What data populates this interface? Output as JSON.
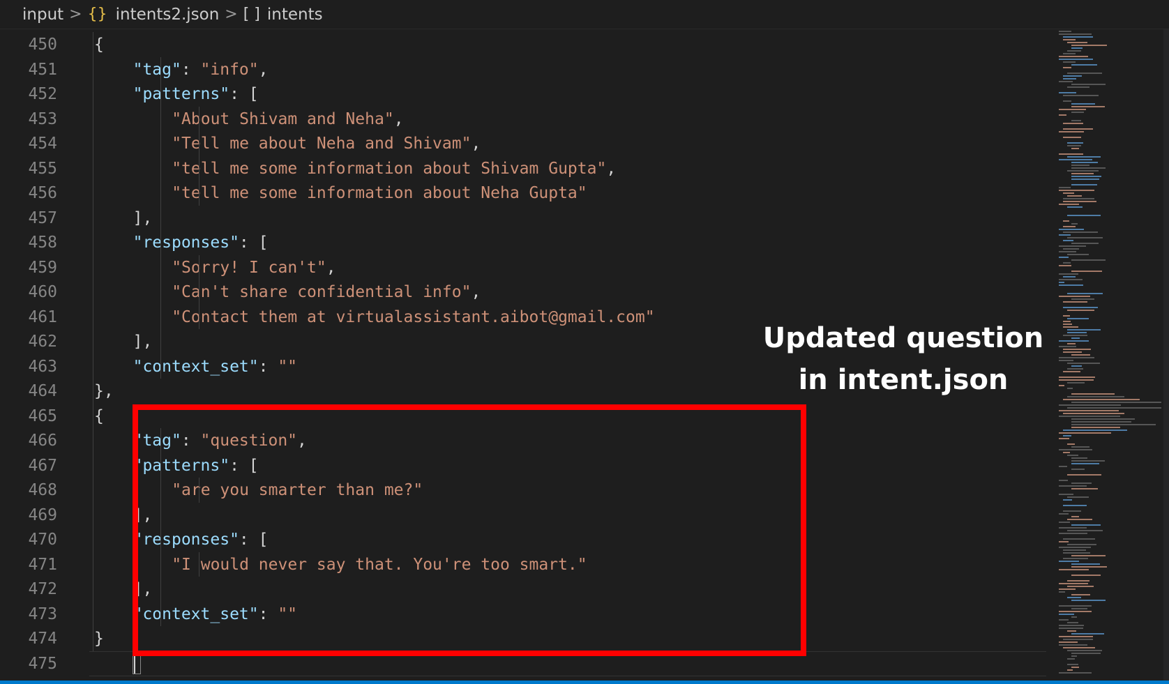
{
  "breadcrumb": {
    "folder": "input",
    "file_icon": "{}",
    "file": "intents2.json",
    "array_icon": "[ ]",
    "symbol": "intents"
  },
  "editor": {
    "lines": [
      {
        "n": "450",
        "segs": [
          [
            "p",
            "{"
          ]
        ]
      },
      {
        "n": "451",
        "segs": [
          [
            "k",
            "\"tag\""
          ],
          [
            "p",
            ": "
          ],
          [
            "s",
            "\"info\""
          ],
          [
            "p",
            ","
          ]
        ]
      },
      {
        "n": "452",
        "segs": [
          [
            "k",
            "\"patterns\""
          ],
          [
            "p",
            ": ["
          ]
        ]
      },
      {
        "n": "453",
        "segs": [
          [
            "s",
            "\"About Shivam and Neha\""
          ],
          [
            "p",
            ","
          ]
        ]
      },
      {
        "n": "454",
        "segs": [
          [
            "s",
            "\"Tell me about Neha and Shivam\""
          ],
          [
            "p",
            ","
          ]
        ]
      },
      {
        "n": "455",
        "segs": [
          [
            "s",
            "\"tell me some information about Shivam Gupta\""
          ],
          [
            "p",
            ","
          ]
        ]
      },
      {
        "n": "456",
        "segs": [
          [
            "s",
            "\"tell me some information about Neha Gupta\""
          ]
        ]
      },
      {
        "n": "457",
        "segs": [
          [
            "p",
            "],"
          ]
        ]
      },
      {
        "n": "458",
        "segs": [
          [
            "k",
            "\"responses\""
          ],
          [
            "p",
            ": ["
          ]
        ]
      },
      {
        "n": "459",
        "segs": [
          [
            "s",
            "\"Sorry! I can't\""
          ],
          [
            "p",
            ","
          ]
        ]
      },
      {
        "n": "460",
        "segs": [
          [
            "s",
            "\"Can't share confidential info\""
          ],
          [
            "p",
            ","
          ]
        ]
      },
      {
        "n": "461",
        "segs": [
          [
            "s",
            "\"Contact them at virtualassistant.aibot@gmail.com\""
          ]
        ]
      },
      {
        "n": "462",
        "segs": [
          [
            "p",
            "],"
          ]
        ]
      },
      {
        "n": "463",
        "segs": [
          [
            "k",
            "\"context_set\""
          ],
          [
            "p",
            ": "
          ],
          [
            "s",
            "\"\""
          ]
        ]
      },
      {
        "n": "464",
        "segs": [
          [
            "p",
            "},"
          ]
        ]
      },
      {
        "n": "465",
        "segs": [
          [
            "p",
            "{"
          ]
        ]
      },
      {
        "n": "466",
        "segs": [
          [
            "k",
            "\"tag\""
          ],
          [
            "p",
            ": "
          ],
          [
            "s",
            "\"question\""
          ],
          [
            "p",
            ","
          ]
        ]
      },
      {
        "n": "467",
        "segs": [
          [
            "k",
            "\"patterns\""
          ],
          [
            "p",
            ": ["
          ]
        ]
      },
      {
        "n": "468",
        "segs": [
          [
            "s",
            "\"are you smarter than me?\""
          ]
        ]
      },
      {
        "n": "469",
        "segs": [
          [
            "p",
            "],"
          ]
        ]
      },
      {
        "n": "470",
        "segs": [
          [
            "k",
            "\"responses\""
          ],
          [
            "p",
            ": ["
          ]
        ]
      },
      {
        "n": "471",
        "segs": [
          [
            "s",
            "\"I would never say that. You're too smart.\""
          ]
        ]
      },
      {
        "n": "472",
        "segs": [
          [
            "p",
            "],"
          ]
        ]
      },
      {
        "n": "473",
        "segs": [
          [
            "k",
            "\"context_set\""
          ],
          [
            "p",
            ": "
          ],
          [
            "s",
            "\"\""
          ]
        ]
      },
      {
        "n": "474",
        "segs": [
          [
            "p",
            "}"
          ]
        ]
      },
      {
        "n": "475",
        "segs": [
          [
            "p",
            ""
          ]
        ]
      }
    ]
  },
  "annotation": {
    "line1": "Updated question",
    "line2": "in intent.json",
    "highlight_color": "#ff0000"
  },
  "theme": {
    "background": "#1e1e1e",
    "key_color": "#9cdcfe",
    "string_color": "#ce9178",
    "line_number_color": "#858585",
    "statusbar_color": "#007acc"
  }
}
